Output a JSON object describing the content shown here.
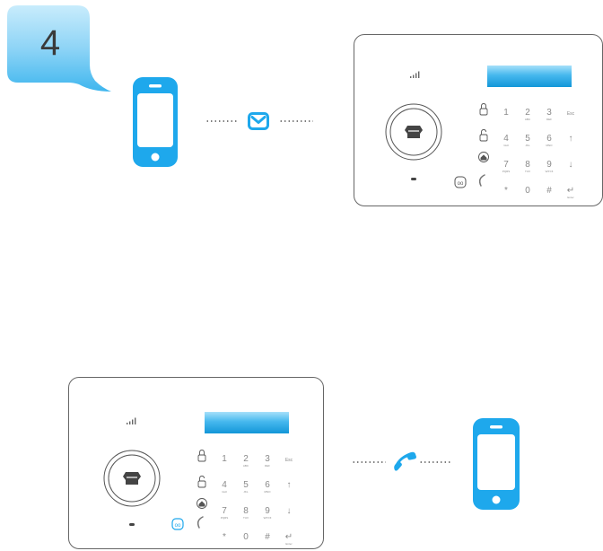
{
  "step": {
    "number": "4"
  },
  "panel": {
    "keys": [
      {
        "row": 0,
        "col": 1,
        "label": "1",
        "sub": ""
      },
      {
        "row": 0,
        "col": 2,
        "label": "2",
        "sub": "ABC"
      },
      {
        "row": 0,
        "col": 3,
        "label": "3",
        "sub": "DEF"
      },
      {
        "row": 0,
        "col": 4,
        "label": "Esc",
        "sub": ""
      },
      {
        "row": 1,
        "col": 1,
        "label": "4",
        "sub": "GHI"
      },
      {
        "row": 1,
        "col": 2,
        "label": "5",
        "sub": "JKL"
      },
      {
        "row": 1,
        "col": 3,
        "label": "6",
        "sub": "MNO"
      },
      {
        "row": 1,
        "col": 4,
        "label": "↑",
        "sub": ""
      },
      {
        "row": 2,
        "col": 1,
        "label": "7",
        "sub": "PQRS"
      },
      {
        "row": 2,
        "col": 2,
        "label": "8",
        "sub": "TUV"
      },
      {
        "row": 2,
        "col": 3,
        "label": "9",
        "sub": "WXYZ"
      },
      {
        "row": 2,
        "col": 4,
        "label": "↓",
        "sub": ""
      },
      {
        "row": 3,
        "col": 1,
        "label": "*",
        "sub": ""
      },
      {
        "row": 3,
        "col": 2,
        "label": "0",
        "sub": ""
      },
      {
        "row": 3,
        "col": 3,
        "label": "#",
        "sub": ""
      },
      {
        "row": 3,
        "col": 4,
        "label": "↵",
        "sub": "Enter"
      }
    ]
  },
  "colors": {
    "accent": "#1ea8ec",
    "badge_light": "#b8e6fb",
    "panel_border": "#666666",
    "key_text": "#8a8a8a",
    "dots": "#6a6a6a"
  },
  "icons": {
    "message": "envelope-icon",
    "call": "phone-handset-icon",
    "smartphone": "smartphone-icon"
  }
}
